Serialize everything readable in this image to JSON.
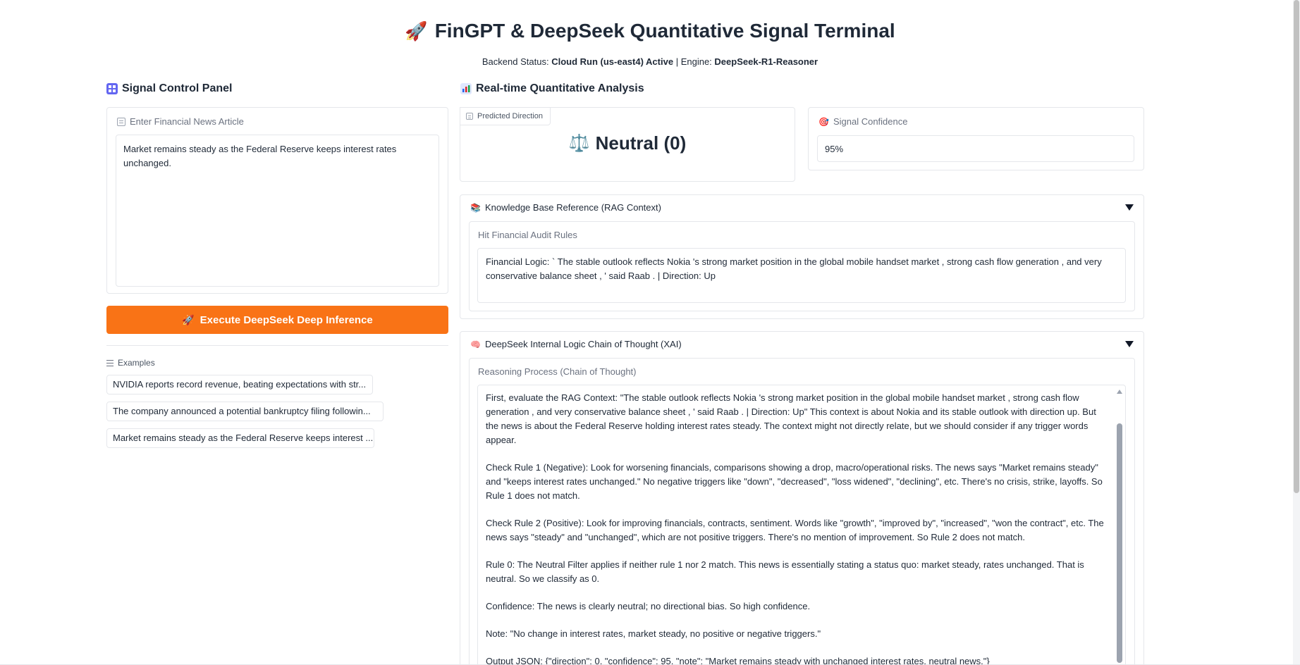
{
  "header": {
    "title": "FinGPT & DeepSeek Quantitative Signal Terminal",
    "status_prefix": "Backend Status:",
    "status_value": "Cloud Run (us-east4) Active",
    "engine_prefix": "Engine:",
    "engine_value": "DeepSeek-R1-Reasoner",
    "separator": "|"
  },
  "left_panel": {
    "heading": "Signal Control Panel",
    "input_label": "Enter Financial News Article",
    "input_value": "Market remains steady as the Federal Reserve keeps interest rates unchanged.",
    "execute_button": "Execute DeepSeek Deep Inference",
    "examples_label": "Examples",
    "examples": [
      "NVIDIA reports record revenue, beating expectations with str...",
      "The company announced a potential bankruptcy filing followin...",
      "Market remains steady as the Federal Reserve keeps interest ..."
    ]
  },
  "right_panel": {
    "heading": "Real-time Quantitative Analysis",
    "direction_label": "Predicted Direction",
    "direction_value": "Neutral (0)",
    "confidence_label": "Signal Confidence",
    "confidence_value": "95%",
    "rag": {
      "header": "Knowledge Base Reference (RAG Context)",
      "field_label": "Hit Financial Audit Rules",
      "field_value": "Financial Logic: ` The stable outlook reflects Nokia 's strong market position in the global mobile handset market , strong cash flow generation , and very conservative balance sheet , ' said Raab . | Direction: Up"
    },
    "cot": {
      "header": "DeepSeek Internal Logic Chain of Thought (XAI)",
      "field_label": "Reasoning Process (Chain of Thought)",
      "paragraphs": [
        "First, evaluate the RAG Context: \"The stable outlook reflects Nokia 's strong market position in the global mobile handset market , strong cash flow generation , and very conservative balance sheet , ' said Raab . | Direction: Up\" This context is about Nokia and its stable outlook with direction up. But the news is about the Federal Reserve holding interest rates steady. The context might not directly relate, but we should consider if any trigger words appear.",
        "Check Rule 1 (Negative): Look for worsening financials, comparisons showing a drop, macro/operational risks. The news says \"Market remains steady\" and \"keeps interest rates unchanged.\" No negative triggers like \"down\", \"decreased\", \"loss widened\", \"declining\", etc. There's no crisis, strike, layoffs. So Rule 1 does not match.",
        "Check Rule 2 (Positive): Look for improving financials, contracts, sentiment. Words like \"growth\", \"improved by\", \"increased\", \"won the contract\", etc. The news says \"steady\" and \"unchanged\", which are not positive triggers. There's no mention of improvement. So Rule 2 does not match.",
        "Rule 0: The Neutral Filter applies if neither rule 1 nor 2 match. This news is essentially stating a status quo: market steady, rates unchanged. That is neutral. So we classify as 0.",
        "Confidence: The news is clearly neutral; no directional bias. So high confidence.",
        "Note: \"No change in interest rates, market steady, no positive or negative triggers.\"",
        "Output JSON: {\"direction\": 0, \"confidence\": 95, \"note\": \"Market remains steady with unchanged interest rates, neutral news.\"}"
      ]
    }
  },
  "icons": {
    "title_icon": "rocket-icon",
    "left_heading_icon": "control-panel-icon",
    "right_heading_icon": "bar-chart-icon",
    "direction_icon": "balance-scale-icon",
    "confidence_icon": "target-icon",
    "rag_icon": "books-icon",
    "cot_icon": "brain-icon"
  },
  "colors": {
    "accent": "#f97316",
    "text": "#1f2937",
    "muted": "#6b7280",
    "border": "#e5e7eb"
  }
}
